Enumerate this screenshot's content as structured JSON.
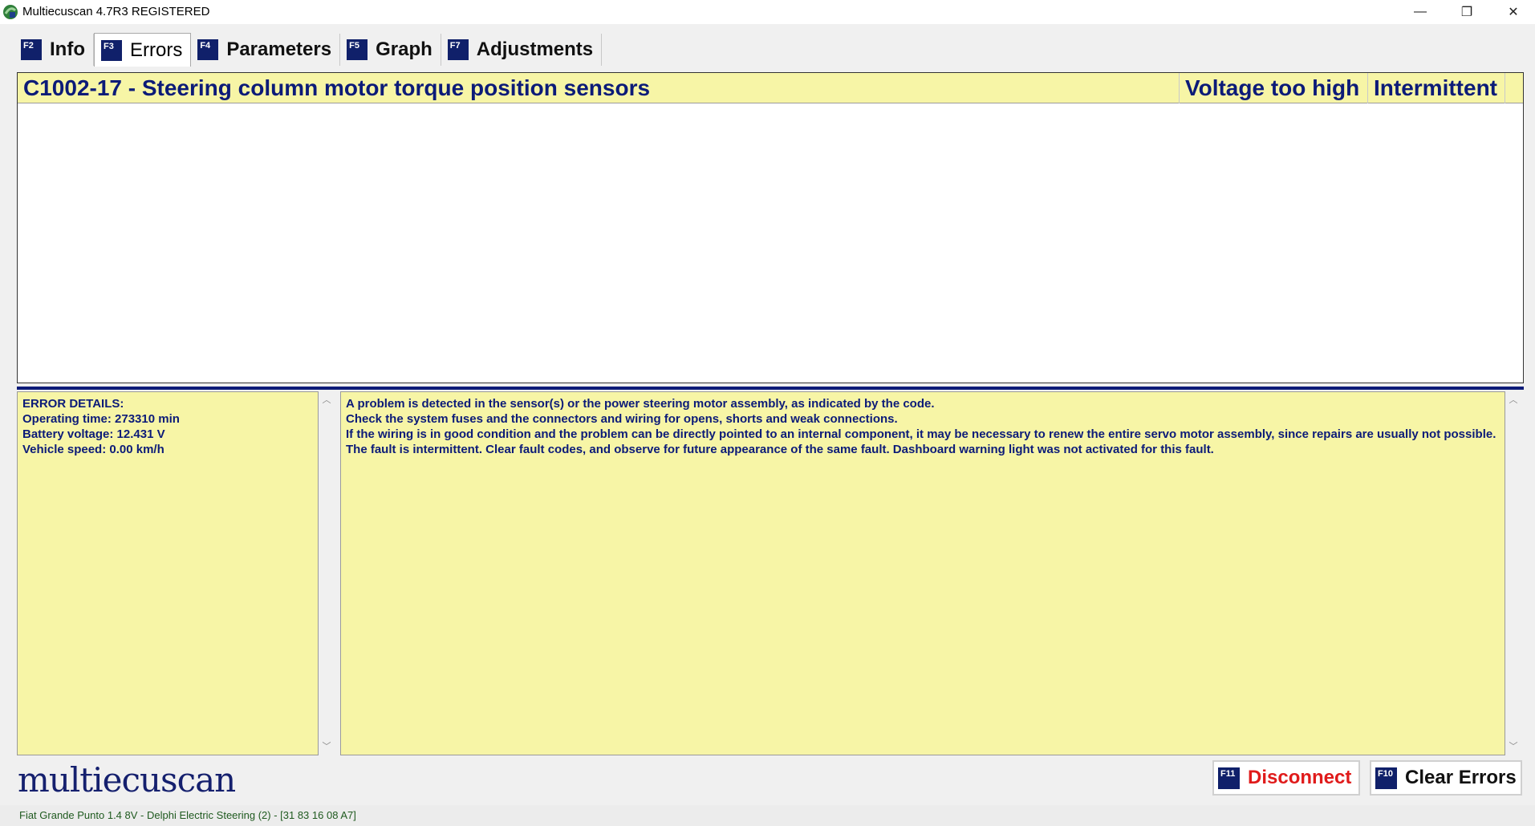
{
  "window": {
    "title": "Multiecuscan 4.7R3 REGISTERED",
    "minimize": "—",
    "maximize": "❐",
    "close": "✕"
  },
  "tabs": [
    {
      "key": "F2",
      "label": "Info"
    },
    {
      "key": "F3",
      "label": "Errors"
    },
    {
      "key": "F4",
      "label": "Parameters"
    },
    {
      "key": "F5",
      "label": "Graph"
    },
    {
      "key": "F7",
      "label": "Adjustments"
    }
  ],
  "error": {
    "title": "C1002-17 - Steering column motor torque position sensors",
    "type": "Voltage too high",
    "status": "Intermittent"
  },
  "details": {
    "heading": "ERROR DETAILS:",
    "lines": [
      "Operating time: 273310 min",
      "Battery voltage: 12.431 V",
      "Vehicle speed: 0.00 km/h"
    ]
  },
  "description": [
    "A problem is detected in the sensor(s) or the power steering motor assembly, as indicated by the code.",
    "Check the system fuses and the connectors and wiring for opens, shorts and weak connections.",
    "If the wiring is in good condition and the problem can be directly pointed to an internal component, it may be necessary to renew the entire servo motor assembly, since repairs are usually not possible.",
    "The fault is intermittent. Clear fault codes, and observe for future appearance of the same fault. Dashboard warning light was not activated for this fault."
  ],
  "logo": "multiecuscan",
  "buttons": {
    "disconnect": {
      "key": "F11",
      "label": "Disconnect"
    },
    "clear": {
      "key": "F10",
      "label": "Clear Errors"
    }
  },
  "status": "Fiat Grande Punto 1.4 8V - Delphi Electric Steering (2) - [31 83 16 08 A7]",
  "colors": {
    "accent": "#0c1b78",
    "highlight": "#f7f5a6",
    "danger": "#e01b1b"
  }
}
